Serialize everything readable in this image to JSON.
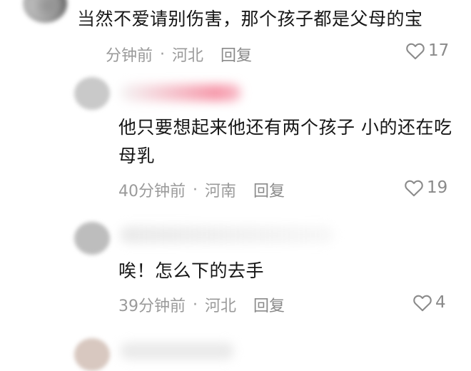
{
  "comments": [
    {
      "text": "当然不爱请别伤害，那个孩子都是父母的宝",
      "time": "分钟前",
      "location": "河北",
      "reply_label": "回复",
      "likes": "17"
    },
    {
      "text_line1": "他只要想起来他还有两个孩子  小的还在吃",
      "text_line2": "母乳",
      "time": "40分钟前",
      "location": "河南",
      "reply_label": "回复",
      "likes": "19"
    },
    {
      "text": "唉！怎么下的去手",
      "time": "39分钟前",
      "location": "河北",
      "reply_label": "回复",
      "likes": "4"
    }
  ],
  "separator": "·",
  "icons": {
    "like": "heart-outline-icon"
  },
  "colors": {
    "text": "#161616",
    "meta": "#9a9a9a",
    "username_highlight": "#f58aa0"
  }
}
